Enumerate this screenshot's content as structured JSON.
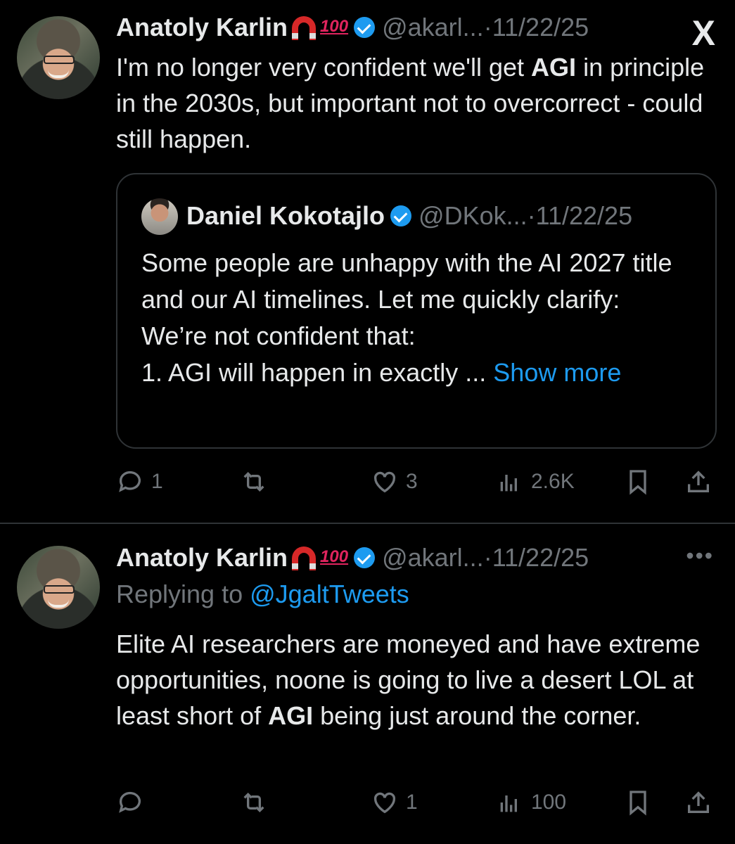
{
  "tweet1": {
    "author_name": "Anatoly Karlin",
    "badge_100": "100",
    "handle": "@akarl...",
    "dot": "·",
    "date": "11/22/25",
    "text_1": "I'm no longer very confident we'll get ",
    "text_bold": "AGI",
    "text_2": " in principle in the 2030s, but important not to overcorrect - could still happen.",
    "quote": {
      "author_name": "Daniel Kokotajlo",
      "handle": "@DKok...",
      "dot": "·",
      "date": "11/22/25",
      "line1": "Some people are unhappy with the AI 2027 title and our AI timelines. Let me quickly clarify:",
      "line2": "We’re not confident that:",
      "line3": "1. AGI will happen in exactly ...",
      "show_more": "Show more"
    },
    "actions": {
      "replies": "1",
      "retweets": "",
      "likes": "3",
      "views": "2.6K"
    }
  },
  "tweet2": {
    "author_name": "Anatoly Karlin",
    "badge_100": "100",
    "handle": "@akarl...",
    "dot": "·",
    "date": "11/22/25",
    "more": "•••",
    "replying_label": "Replying to ",
    "replying_handle": "@JgaltTweets",
    "text_1": "Elite AI researchers are moneyed and have extreme opportunities, noone is going to live a desert LOL at least short of ",
    "text_bold": "AGI",
    "text_2": " being just around the corner.",
    "actions": {
      "replies": "",
      "retweets": "",
      "likes": "1",
      "views": "100"
    }
  },
  "icons": {
    "x_logo": "X",
    "reply": "reply-icon",
    "retweet": "retweet-icon",
    "like": "heart-icon",
    "views": "views-icon",
    "bookmark": "bookmark-icon",
    "share": "share-icon"
  },
  "colors": {
    "background": "#000000",
    "text": "#e7e9ea",
    "secondary": "#71767b",
    "accent": "#1d9bf0",
    "border": "#2f3336"
  }
}
